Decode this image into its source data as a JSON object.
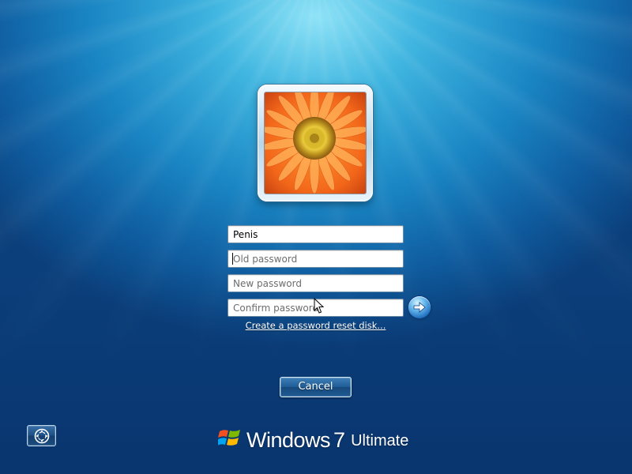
{
  "username_field": {
    "value": "Penis"
  },
  "old_password_field": {
    "placeholder": "Old password",
    "value": ""
  },
  "new_password_field": {
    "placeholder": "New password",
    "value": ""
  },
  "confirm_password_field": {
    "placeholder": "Confirm password",
    "value": ""
  },
  "reset_link": {
    "label": "Create a password reset disk..."
  },
  "cancel_button": {
    "label": "Cancel"
  },
  "icons": {
    "avatar": "orange-gerbera-flower-avatar",
    "submit": "arrow-right-icon",
    "ease_of_access": "ease-of-access-icon",
    "logo": "windows-flag-icon",
    "pointer": "mouse-pointer-icon"
  },
  "branding": {
    "name": "Windows",
    "version": "7",
    "edition": "Ultimate"
  },
  "colors": {
    "background_top": "#8fe3f7",
    "background_mid": "#1a86c4",
    "background_bottom": "#0b3f7b",
    "button_blue": "#1f5c96",
    "link_text": "#ffffff"
  }
}
